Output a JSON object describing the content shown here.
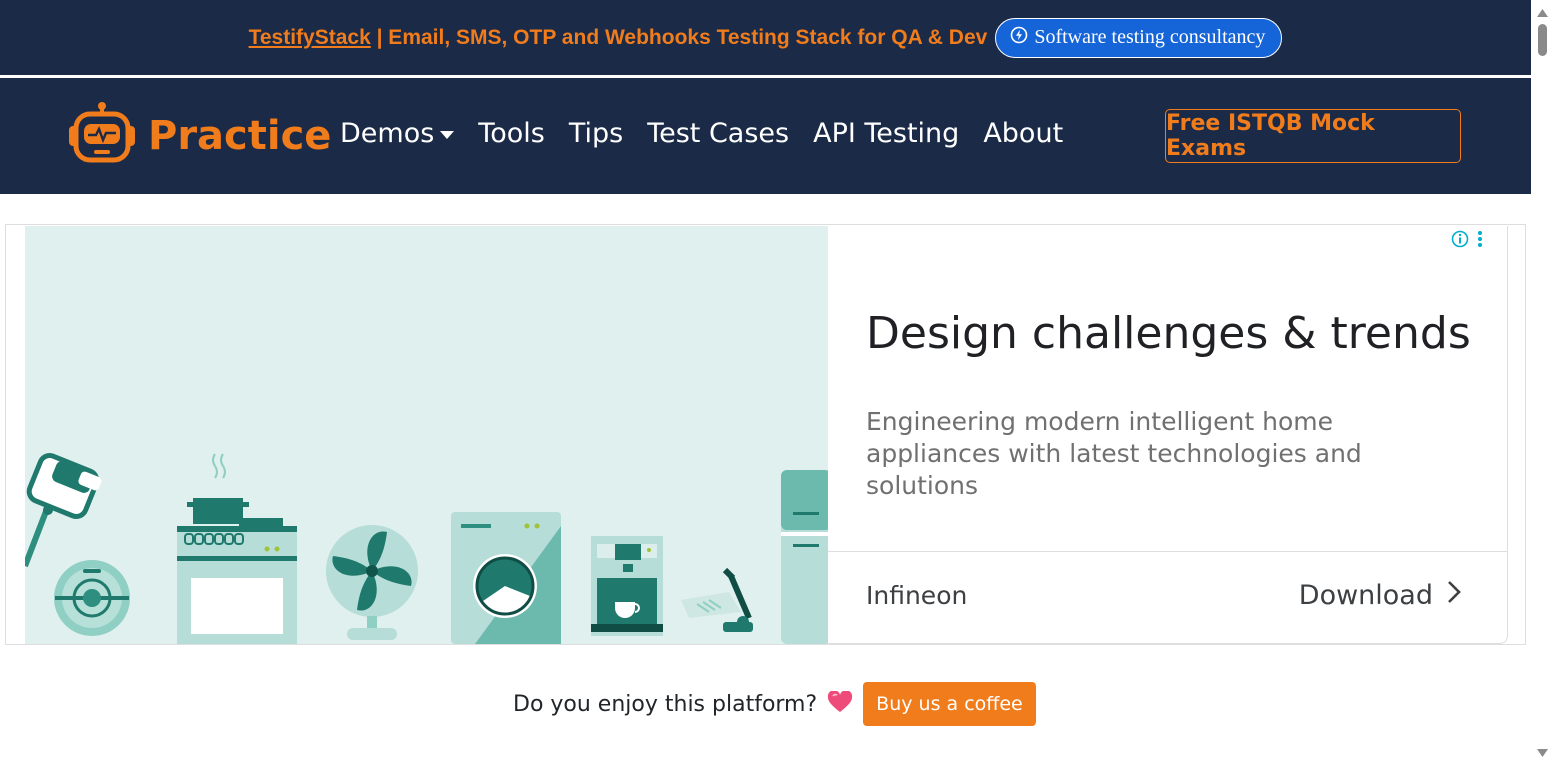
{
  "banner": {
    "brand_link": "TestifyStack",
    "tagline": " | Email, SMS, OTP and Webhooks Testing Stack for QA & Dev",
    "consult_label": "Software testing consultancy"
  },
  "navbar": {
    "brand": "Practice",
    "links": [
      "Demos",
      "Tools",
      "Tips",
      "Test Cases",
      "API Testing",
      "About"
    ],
    "cta": "Free ISTQB Mock Exams"
  },
  "ad": {
    "headline": "Design challenges & trends",
    "body": "Engineering modern intelligent home appliances with latest technologies and solutions",
    "advertiser": "Infineon",
    "cta": "Download"
  },
  "footer": {
    "question": "Do you enjoy this platform?",
    "button": "Buy us a coffee"
  },
  "colors": {
    "navy": "#1b2a47",
    "orange": "#f07c1c",
    "blue_button": "#1565d8",
    "ad_teal": "#1f7a6d"
  },
  "icons": {
    "consult": "lightning-circle-icon",
    "brand": "robot-icon",
    "ad_info": "info-icon",
    "ad_menu": "vertical-dots-icon",
    "ad_cta": "chevron-right-icon",
    "heart": "heart-icon"
  }
}
